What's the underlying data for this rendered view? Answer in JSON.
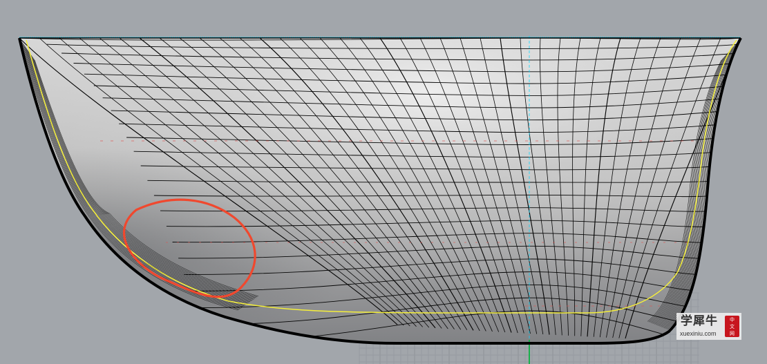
{
  "viewport": {
    "description_label": "",
    "background_color": "#a2a6ab",
    "grid_color": "#8f9399",
    "surface_shadow_color": "#707378",
    "surface_highlight_color": "#e8e8e8",
    "isocurve_color": "#000000",
    "yellow_curve_color": "#f5ef3a",
    "cyan_axis_color": "#00d7ff",
    "green_axis_color": "#19b04b",
    "red_dash_color": "#e0524f",
    "annotation_color": "#f0482e"
  },
  "watermark": {
    "title": "学犀牛",
    "url": "xuexiniu.com",
    "seal_line1": "中",
    "seal_line2": "文",
    "seal_line3": "网",
    "seal_color": "#c7161e"
  }
}
